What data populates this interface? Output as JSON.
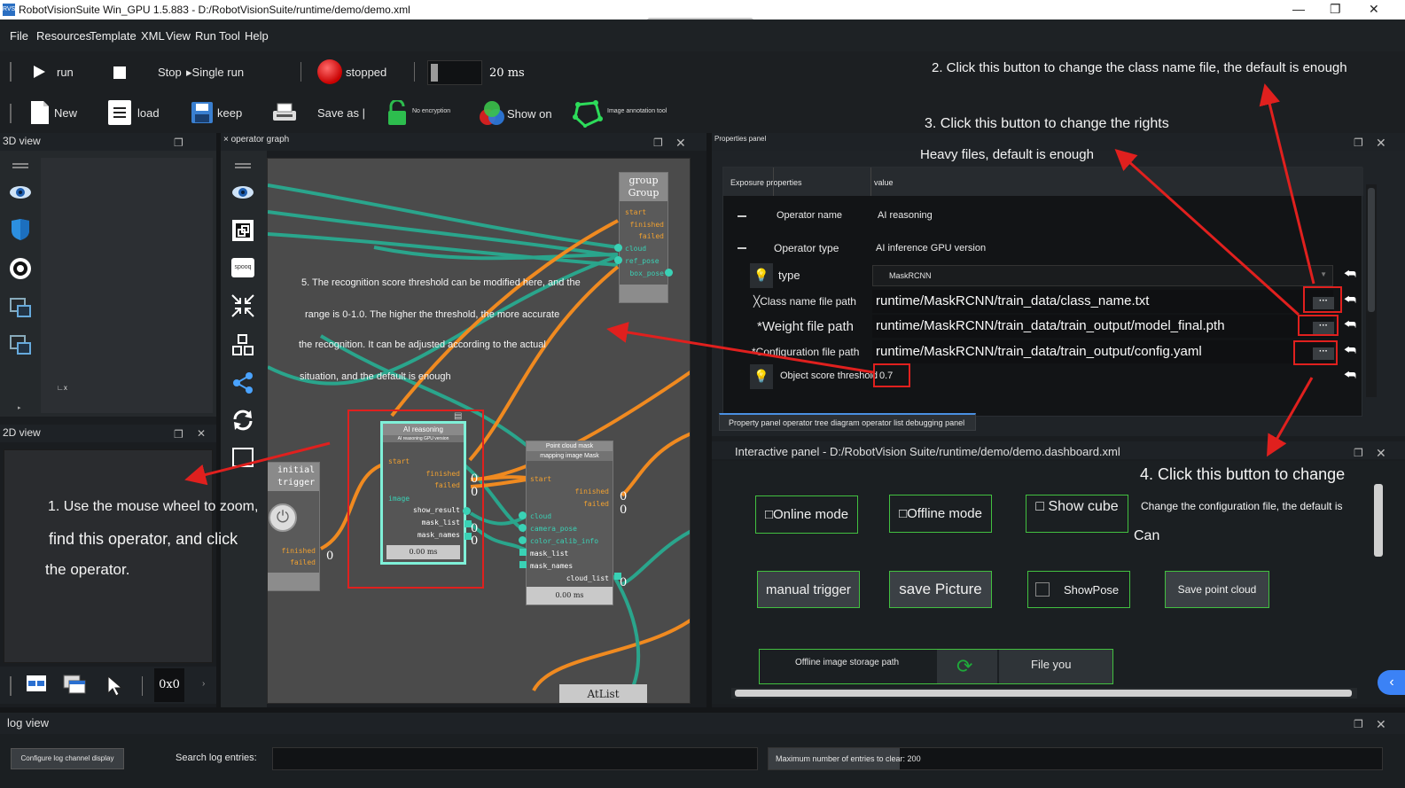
{
  "window": {
    "title": "RobotVisionSuite Win_GPU 1.5.883 - D:/RobotVisionSuite/runtime/demo/demo.xml",
    "app_icon": "RVS"
  },
  "menu": [
    "File",
    "Resources",
    "Template",
    "XML",
    "View",
    "Run",
    "Tool",
    "Help"
  ],
  "toolbar_run": {
    "run": "run",
    "stop": "Stop",
    "single_run": "▸Single run",
    "status": "stopped",
    "interval": "20",
    "interval_unit": "ms"
  },
  "toolbar_file": {
    "new": "New",
    "load": "load",
    "keep": "keep",
    "save_as": "Save as |",
    "no_encryption": "No encryption",
    "show_on": "Show on",
    "annotation_tool": "Image annotation tool"
  },
  "panels": {
    "view3d": "3D view",
    "operator_graph": "× operator graph",
    "properties": "Properties panel",
    "view2d": "2D view",
    "interactive": "Interactive panel - D:/RobotVision Suite/runtime/demo/demo.dashboard.xml",
    "log": "log view"
  },
  "view2d": {
    "size": "0x0"
  },
  "annotations": {
    "a1_l1": "1. Use the mouse wheel to zoom,",
    "a1_l2": "find this operator, and click",
    "a1_l3": "the operator.",
    "a2": "2. Click this button to change the class name file, the default is enough",
    "a3_l1": "3. Click this button to change the rights",
    "a3_l2": "Heavy files, default is enough",
    "a4_l1": "4. Click this button to change",
    "a4_l2": "Change the configuration file, the default is",
    "a4_l3": "Can",
    "a5_l1": "5. The recognition score threshold can be modified here, and the",
    "a5_l2": "range is 0-1.0. The higher the threshold, the more accurate",
    "a5_l3": "the recognition. It can be adjusted according to the actual",
    "a5_l4": "situation, and the default is enough"
  },
  "graph": {
    "group": {
      "title1": "group",
      "title2": "Group",
      "ports": [
        "start",
        "finished",
        "failed",
        "cloud",
        "ref_pose",
        "box_pose"
      ]
    },
    "trigger": {
      "title1": "initial",
      "title2": "trigger",
      "ports": [
        "finished",
        "failed"
      ],
      "out0": "0"
    },
    "ai": {
      "title": "AI reasoning",
      "subtitle": "AI reasoning GPU version",
      "ports_in": [
        "start",
        "image"
      ],
      "ports_out": [
        "finished",
        "failed",
        "show_result",
        "mask_list",
        "mask_names"
      ],
      "time": "0.00 ms",
      "z1": "0",
      "z2": "0",
      "z3": "0",
      "z4": "0"
    },
    "pcm": {
      "title": "Point cloud mask",
      "subtitle": "mapping image Mask",
      "ports": [
        "start",
        "finished",
        "failed",
        "cloud",
        "camera_pose",
        "color_calib_info",
        "mask_list",
        "mask_names",
        "cloud_list"
      ],
      "time": "0.00 ms",
      "z1": "0",
      "z2": "0",
      "z3": "0"
    },
    "atlist": "AtList"
  },
  "properties": {
    "header": {
      "col1": "Exposure properties",
      "col2": "value"
    },
    "rows": [
      {
        "name": "Operator name",
        "value": "AI reasoning"
      },
      {
        "name": "Operator type",
        "value": "AI inference GPU version"
      },
      {
        "name": "type",
        "value": "MaskRCNN"
      },
      {
        "name": "╳Class name file path",
        "value": "runtime/MaskRCNN/train_data/class_name.txt"
      },
      {
        "name": "*Weight file path",
        "value": "runtime/MaskRCNN/train_data/train_output/model_final.pth"
      },
      {
        "name": "*Configuration file path",
        "value": "runtime/MaskRCNN/train_data/train_output/config.yaml"
      },
      {
        "name": "Object score threshold",
        "value": "0.7"
      }
    ],
    "tabs": "Property panel operator tree diagram operator list debugging panel"
  },
  "dashboard": {
    "online": "□Online mode",
    "offline": "□Offline mode",
    "show_cube": "□ Show cube",
    "manual_trigger": "manual trigger",
    "save_picture": "save Picture",
    "show_pose": "ShowPose",
    "save_cloud": "Save point cloud",
    "storage_label": "Offline image storage path",
    "file_btn": "File you"
  },
  "log": {
    "config_btn": "Configure log channel display",
    "search_label": "Search log entries:",
    "search_value": "",
    "max_entries": "Maximum number of entries to clear: 200"
  },
  "colors": {
    "accent_green": "#42c040",
    "annotation_red": "#e0201e",
    "wire_orange": "#f08a20",
    "wire_teal": "#2aa58c",
    "port_teal": "#3ad1b5"
  }
}
